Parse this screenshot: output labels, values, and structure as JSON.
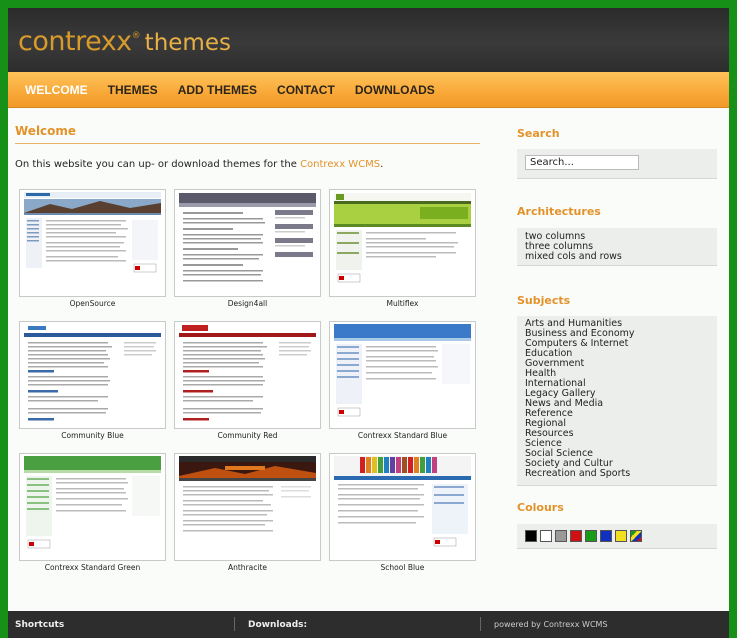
{
  "header": {
    "brand": "contrexx",
    "registered": "®",
    "subtitle": "themes"
  },
  "nav": {
    "items": [
      {
        "label": "WELCOME",
        "active": true
      },
      {
        "label": "THEMES",
        "active": false
      },
      {
        "label": "ADD THEMES",
        "active": false
      },
      {
        "label": "CONTACT",
        "active": false
      },
      {
        "label": "DOWNLOADS",
        "active": false
      }
    ]
  },
  "main": {
    "title": "Welcome",
    "intro_text": "On this website you can up- or download themes for the",
    "intro_link": "Contrexx WCMS",
    "intro_end": ".",
    "themes": [
      {
        "label": "OpenSource"
      },
      {
        "label": "Design4all"
      },
      {
        "label": "Multiflex"
      },
      {
        "label": "Community Blue"
      },
      {
        "label": "Community Red"
      },
      {
        "label": "Contrexx Standard Blue"
      },
      {
        "label": "Contrexx Standard Green"
      },
      {
        "label": "Anthracite"
      },
      {
        "label": "School Blue"
      }
    ]
  },
  "sidebar": {
    "search": {
      "heading": "Search",
      "value": "Search..."
    },
    "architectures": {
      "heading": "Architectures",
      "items": [
        "two columns",
        "three columns",
        "mixed cols and rows"
      ]
    },
    "subjects": {
      "heading": "Subjects",
      "items": [
        "Arts and Humanities",
        "Business and Economy",
        "Computers & Internet",
        "Education",
        "Government",
        "Health",
        "International",
        "Legacy Gallery",
        "News and Media",
        "Reference",
        "Regional",
        "Resources",
        "Science",
        "Social Science",
        "Society and Cultur",
        "Recreation and Sports"
      ]
    },
    "colours": {
      "heading": "Colours",
      "swatches": [
        "#000000",
        "#ffffff",
        "#9a9a9a",
        "#d01010",
        "#1a9a1a",
        "#1030c0",
        "#f2e020",
        "multicolor"
      ]
    }
  },
  "footer": {
    "shortcuts": "Shortcuts",
    "downloads": "Downloads:",
    "powered": "powered by Contrexx WCMS"
  }
}
